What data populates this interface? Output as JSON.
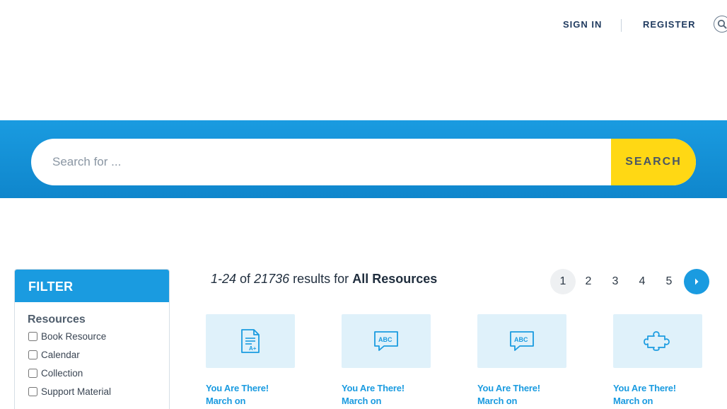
{
  "nav": {
    "sign_in": "SIGN IN",
    "register": "REGISTER",
    "search_icon": "search-icon"
  },
  "search": {
    "placeholder": "Search for ...",
    "button_label": "SEARCH"
  },
  "filter": {
    "title": "FILTER",
    "section_title": "Resources",
    "options": [
      {
        "label": "Book Resource",
        "checked": false
      },
      {
        "label": "Calendar",
        "checked": false
      },
      {
        "label": "Collection",
        "checked": false
      },
      {
        "label": "Support Material",
        "checked": false
      }
    ]
  },
  "results": {
    "range": "1-24",
    "of": "of",
    "total": "21736",
    "results_for": "results for",
    "scope": "All Resources"
  },
  "pagination": {
    "pages": [
      "1",
      "2",
      "3",
      "4",
      "5"
    ],
    "current": "1",
    "next_icon": "chevron-right-icon"
  },
  "cards": [
    {
      "icon": "document-grade-icon",
      "title_line1": "You Are There!",
      "title_line2": "March on"
    },
    {
      "icon": "abc-speech-bubble-icon",
      "title_line1": "You Are There!",
      "title_line2": "March on"
    },
    {
      "icon": "abc-speech-bubble-icon",
      "title_line1": "You Are There!",
      "title_line2": "March on"
    },
    {
      "icon": "puzzle-piece-icon",
      "title_line1": "You Are There!",
      "title_line2": "March on"
    }
  ],
  "colors": {
    "brand_blue": "#1a9be0",
    "search_yellow": "#ffd814",
    "card_bg": "#dff1fa"
  }
}
